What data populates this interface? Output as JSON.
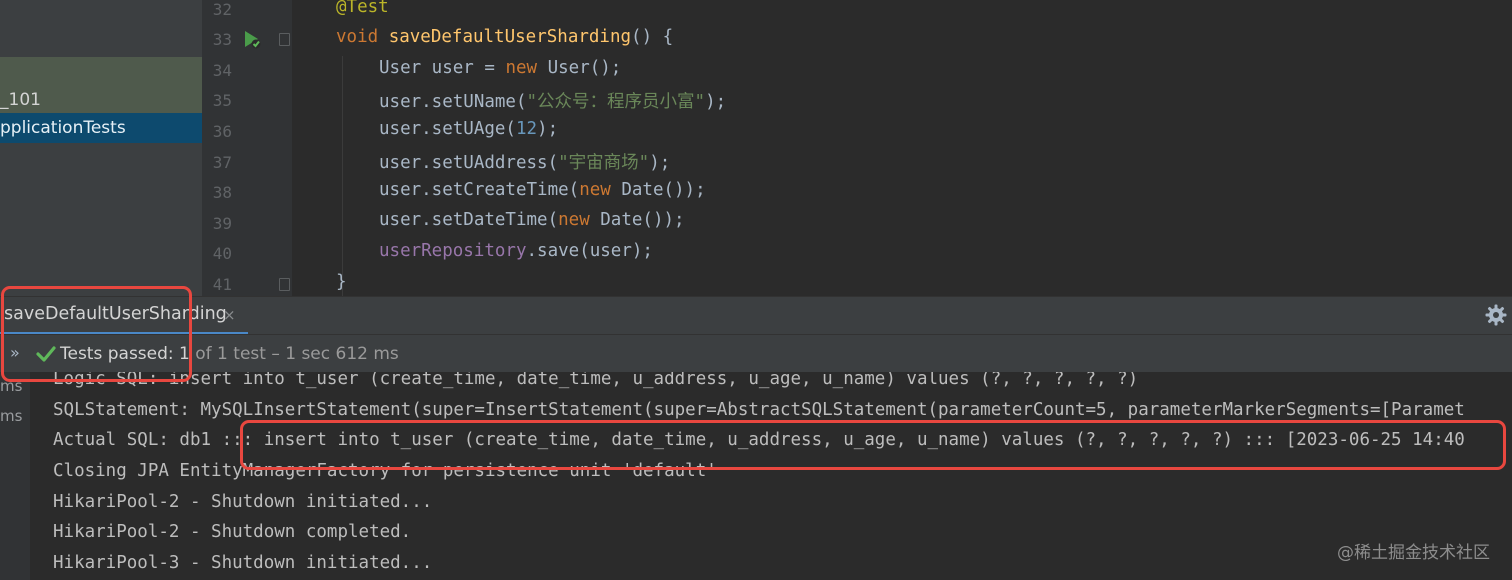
{
  "project_tree": {
    "items": [
      {
        "label": ""
      },
      {
        "label": "_101"
      },
      {
        "label": "pplicationTests"
      }
    ]
  },
  "editor": {
    "line_numbers": [
      "32",
      "33",
      "34",
      "35",
      "36",
      "37",
      "38",
      "39",
      "40",
      "41"
    ],
    "code": {
      "l32": {
        "annotation": "@Test"
      },
      "l33": {
        "kw": "void",
        "method": "saveDefaultUserSharding",
        "rest": "() {"
      },
      "l34": {
        "a": "User user = ",
        "kw": "new",
        "b": " User();"
      },
      "l35": {
        "a": "user.setUName(",
        "str": "\"公众号：程序员小富\"",
        "b": ");"
      },
      "l36": {
        "a": "user.setUAge(",
        "num": "12",
        "b": ");"
      },
      "l37": {
        "a": "user.setUAddress(",
        "str": "\"宇宙商场\"",
        "b": ");"
      },
      "l38": {
        "a": "user.setCreateTime(",
        "kw": "new",
        "b": " Date());"
      },
      "l39": {
        "a": "user.setDateTime(",
        "kw": "new",
        "b": " Date());"
      },
      "l40": {
        "field": "userRepository",
        "b": ".save(user);"
      },
      "l41": {
        "a": "}"
      }
    }
  },
  "run_panel": {
    "tab_label": "saveDefaultUserSharding",
    "tab_close": "×",
    "chevron": "»",
    "status_passed": "Tests passed: 1",
    "status_detail": " of 1 test – 1 sec 612 ms",
    "tree_times": [
      "ms",
      "ms"
    ],
    "console_lines": [
      "Logic SQL: insert into t_user (create_time, date_time, u_address, u_age, u_name) values (?, ?, ?, ?, ?)",
      "SQLStatement: MySQLInsertStatement(super=InsertStatement(super=AbstractSQLStatement(parameterCount=5, parameterMarkerSegments=[Paramet",
      "Actual SQL: db1 ::: insert into t_user (create_time, date_time, u_address, u_age, u_name) values (?, ?, ?, ?, ?) ::: [2023-06-25 14:40",
      "Closing JPA EntityManagerFactory for persistence unit 'default'",
      "HikariPool-2 - Shutdown initiated...",
      "HikariPool-2 - Shutdown completed.",
      "HikariPool-3 - Shutdown initiated..."
    ]
  },
  "watermark": "@稀土掘金技术社区",
  "colors": {
    "highlight": "#e8473f",
    "passed": "#5fb85a",
    "accent": "#4a88c7"
  },
  "icons": [
    "run-test-icon",
    "fold-marker-icon",
    "close-icon",
    "chevron-icon",
    "check-icon",
    "gear-icon"
  ]
}
